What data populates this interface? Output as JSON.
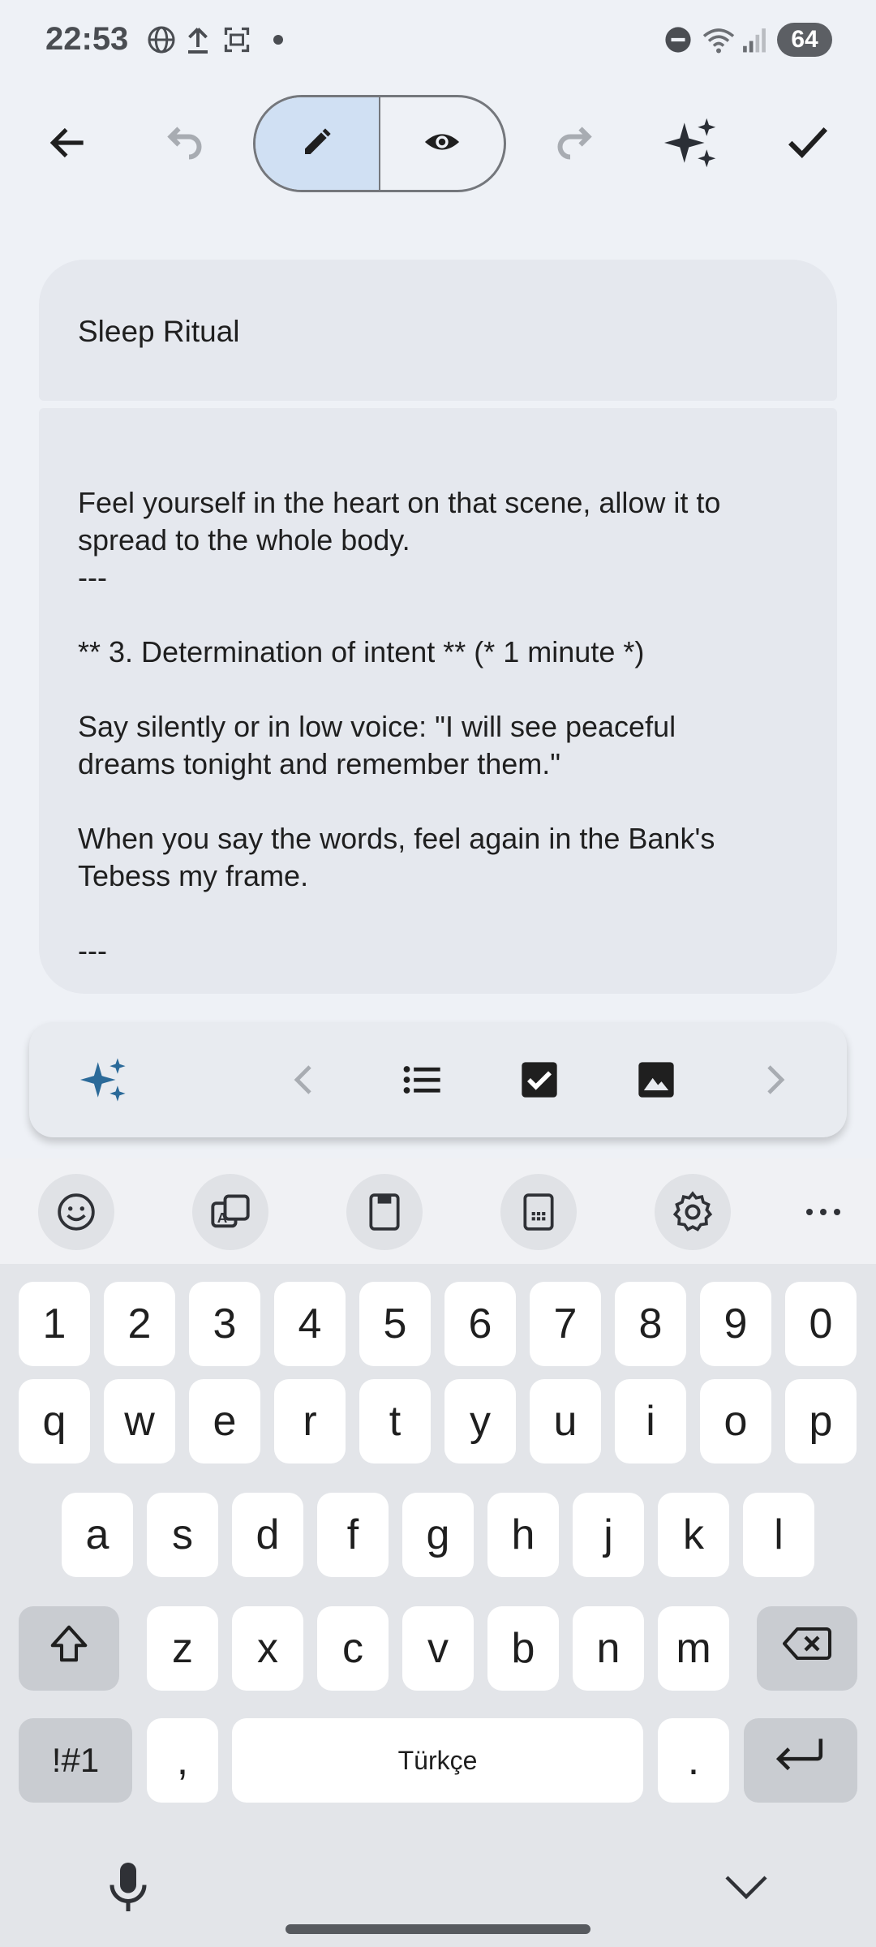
{
  "status_bar": {
    "time": "22:53",
    "battery": "64",
    "icons": [
      "globe-icon",
      "upload-icon",
      "screenshot-icon",
      "dot-icon",
      "dnd-icon",
      "wifi-icon",
      "signal-icon"
    ]
  },
  "toolbar": {
    "icons": [
      "back-arrow-icon",
      "undo-icon",
      "pencil-icon",
      "eye-icon",
      "redo-icon",
      "sparkle-icon",
      "check-icon"
    ],
    "active_mode": "edit"
  },
  "note": {
    "title": "Sleep Ritual",
    "body_lines": [
      "Feel yourself in the heart on that scene, allow it to",
      "spread to the whole body.",
      "---",
      "",
      "** 3. Determination of intent ** (* 1 minute *)",
      "",
      "Say silently or in low voice: \"I will see peaceful",
      "dreams tonight and remember them.\"",
      "",
      "When you say the words, feel again in the Bank's",
      "Tebess my frame.",
      "",
      "---"
    ]
  },
  "format_bar": {
    "icons": [
      "ai-sparkle-icon",
      "chevron-left-icon",
      "bulleted-list-icon",
      "checkbox-icon",
      "image-icon",
      "chevron-right-icon"
    ]
  },
  "keyboard": {
    "tools": [
      "emoji-icon",
      "translate-icon",
      "clipboard-icon",
      "one-handed-icon",
      "settings-icon",
      "more-icon"
    ],
    "row_numbers": [
      "1",
      "2",
      "3",
      "4",
      "5",
      "6",
      "7",
      "8",
      "9",
      "0"
    ],
    "row_q": [
      "q",
      "w",
      "e",
      "r",
      "t",
      "y",
      "u",
      "i",
      "o",
      "p"
    ],
    "row_a": [
      "a",
      "s",
      "d",
      "f",
      "g",
      "h",
      "j",
      "k",
      "l"
    ],
    "row_z": [
      "z",
      "x",
      "c",
      "v",
      "b",
      "n",
      "m"
    ],
    "symbols_label": "!#1",
    "comma_label": ",",
    "space_label": "Türkçe",
    "period_label": "."
  },
  "colors": {
    "background": "#eef1f6",
    "card": "#e5e8ee",
    "active_toggle": "#d0e0f3",
    "sparkle_blue": "#2b6a99"
  }
}
